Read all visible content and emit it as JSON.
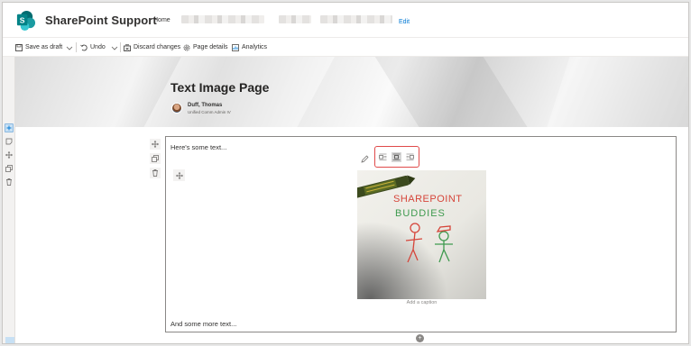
{
  "site": {
    "title": "SharePoint Support",
    "logo_letter": "S",
    "nav_home": "Home",
    "edit_label": "Edit"
  },
  "command_bar": {
    "save_as_draft": "Save as draft",
    "undo": "Undo",
    "discard_changes": "Discard changes",
    "page_details": "Page details",
    "analytics": "Analytics"
  },
  "banner": {
    "page_title": "Text Image Page",
    "author_name": "Duff, Thomas",
    "author_role": "Unified Comm Admin IV"
  },
  "canvas": {
    "text_top": "Here's some text...",
    "text_bottom": "And some more text...",
    "image_caption_placeholder": "Add a caption",
    "image_title_line1": "SHAREPOINT",
    "image_title_line2": "BUDDIES",
    "image_alignment": "center",
    "alignment_options": [
      "left",
      "center",
      "right"
    ]
  },
  "colors": {
    "brand": "#038387",
    "link": "#0078d4",
    "highlight_border": "#e04a4a"
  },
  "icons": {
    "logo": "sharepoint-logo",
    "save": "save-icon",
    "undo": "undo-icon",
    "discard": "discard-icon",
    "page_details": "gear-icon",
    "analytics": "chart-icon",
    "edit_image": "pencil-icon",
    "move": "move-icon",
    "duplicate": "copy-icon",
    "delete": "trash-icon",
    "add_section": "plus-icon"
  }
}
